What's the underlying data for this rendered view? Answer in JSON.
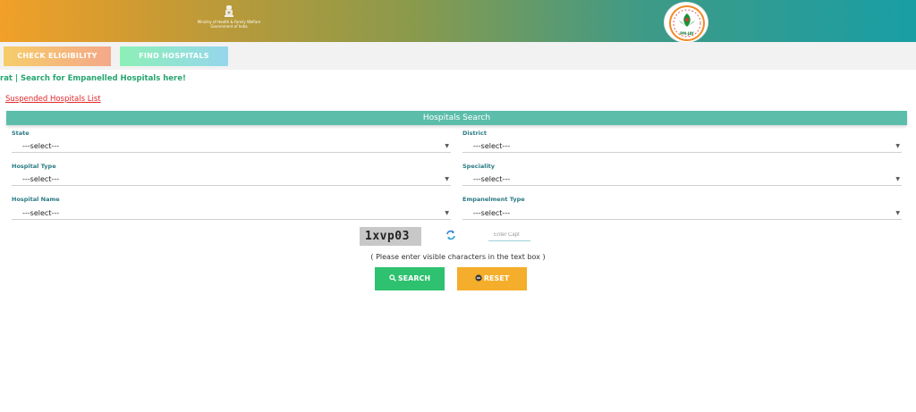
{
  "header": {
    "ministry_line1": "Ministry of Health & Family Welfare",
    "ministry_line2": "Government of India",
    "logo_text": "PM-JAY",
    "colors": {
      "gradient_start": "#f1a028",
      "gradient_end": "#199ea4"
    }
  },
  "tabs": [
    {
      "label": "CHECK ELIGIBILITY"
    },
    {
      "label": "FIND HOSPITALS"
    }
  ],
  "marquee_text": "rat | Search for Empanelled Hospitals here!",
  "suspended_link": "Suspended Hospitals List",
  "search_panel": {
    "title": "Hospitals Search",
    "fields": {
      "state": {
        "label": "State",
        "value": "---select---"
      },
      "district": {
        "label": "District",
        "value": "---select---"
      },
      "hospital_type": {
        "label": "Hospital Type",
        "value": "---select---"
      },
      "speciality": {
        "label": "Speciality",
        "value": "---select---"
      },
      "hospital_name": {
        "label": "Hospital Name",
        "value": "---select---"
      },
      "empanelment_type": {
        "label": "Empanelment Type",
        "value": "---select---"
      }
    }
  },
  "captcha": {
    "code": "1xvp03",
    "placeholder": "Enter Capt",
    "hint": "( Please enter visible characters in the text box )"
  },
  "buttons": {
    "search": "SEARCH",
    "reset": "RESET",
    "search_icon": "search-icon",
    "reset_icon": "minus-circle-icon"
  }
}
